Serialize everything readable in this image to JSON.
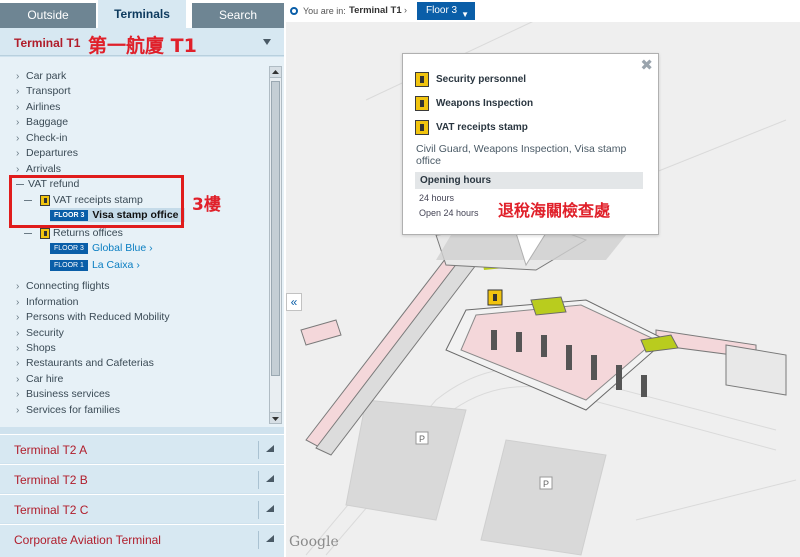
{
  "tabs": [
    {
      "label": "Outside",
      "active": false
    },
    {
      "label": "Terminals",
      "active": true
    },
    {
      "label": "Search",
      "active": false
    }
  ],
  "terminal_t1": {
    "title": "Terminal T1",
    "annotation": "第一航廈 T1"
  },
  "list": {
    "items_top": [
      "Car park",
      "Transport",
      "Airlines",
      "Baggage",
      "Check-in",
      "Departures",
      "Arrivals"
    ],
    "vat_refund": "VAT refund",
    "vat_receipts_stamp": "VAT receipts stamp",
    "visa_stamp": {
      "floor": "FLOOR 3",
      "label": "Visa stamp office"
    },
    "returns_offices": "Returns offices",
    "global_blue": {
      "floor": "FLOOR 3",
      "label": "Global Blue"
    },
    "la_caixa": {
      "floor": "FLOOR 1",
      "label": "La Caixa"
    },
    "items_bottom": [
      "Connecting flights",
      "Information",
      "Persons with Reduced Mobility",
      "Security",
      "Shops",
      "Restaurants and Cafeterias",
      "Car hire",
      "Business services",
      "Services for families"
    ],
    "floor_annotation": "3樓"
  },
  "terminals": [
    "Terminal T2 A",
    "Terminal T2 B",
    "Terminal T2 C",
    "Corporate Aviation Terminal"
  ],
  "map": {
    "you_are_in": "You are in:",
    "terminal": "Terminal T1",
    "floor": "Floor 3",
    "collapse_icon": "«",
    "logo": "Google"
  },
  "popup": {
    "items": [
      "Security personnel",
      "Weapons Inspection",
      "VAT receipts stamp"
    ],
    "description": "Civil Guard, Weapons Inspection, Visa stamp office",
    "opening_hours_title": "Opening hours",
    "hours_1": "24 hours",
    "hours_2": "Open 24 hours",
    "annotation": "退稅海關檢查處",
    "close_icon": "✖"
  },
  "parking_label": "P",
  "colors": {
    "accent_blue": "#0a5ea8",
    "terminal_red": "#b01d2b",
    "annotation_red": "#e0202a",
    "panel_bg": "#cfe2ee",
    "highlight_green": "#b9cc1e"
  }
}
